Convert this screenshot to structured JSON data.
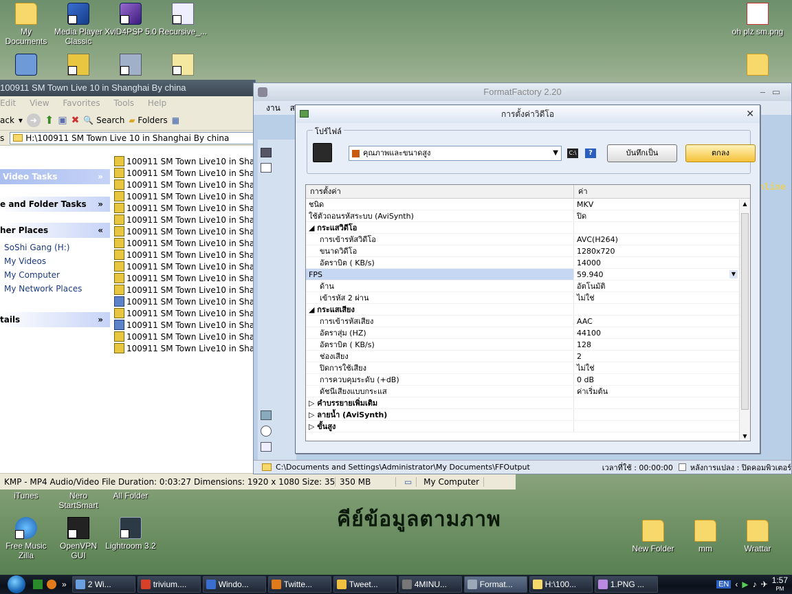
{
  "desktop_icons": [
    {
      "label": "My Documents",
      "icon": "my-documents-icon"
    },
    {
      "label": "Media Player Classic",
      "icon": "media-player-icon"
    },
    {
      "label": "XviD4PSP 5.0",
      "icon": "xvid-icon"
    },
    {
      "label": "Recursive_...",
      "icon": "recursive-icon"
    },
    {
      "label": "oh plz sm.png",
      "icon": "png-file-icon"
    },
    {
      "label": "iTunes",
      "icon": "itunes-icon"
    },
    {
      "label": "Nero StartSmart",
      "icon": "nero-icon"
    },
    {
      "label": "All Folder",
      "icon": "folder-icon"
    },
    {
      "label": "Free Music Zilla",
      "icon": "music-icon"
    },
    {
      "label": "OpenVPN GUI",
      "icon": "openvpn-icon"
    },
    {
      "label": "Lightroom 3.2",
      "icon": "lightroom-icon"
    },
    {
      "label": "New Folder",
      "icon": "folder-icon"
    },
    {
      "label": "mm",
      "icon": "folder-icon"
    },
    {
      "label": "Wrattar",
      "icon": "folder-icon"
    }
  ],
  "explorer": {
    "title": "100911 SM Town Live 10 in Shanghai By china",
    "menu": [
      "Edit",
      "View",
      "Favorites",
      "Tools",
      "Help"
    ],
    "toolbar": {
      "back": "ack",
      "search": "Search",
      "folders": "Folders"
    },
    "address": "H:\\100911 SM Town Live 10 in Shanghai By china",
    "address_label": "s",
    "taskpane": {
      "video_tasks": "Video Tasks",
      "file_folder_tasks": "e and Folder Tasks",
      "other_places": "her Places",
      "places": [
        "SoShi Gang (H:)",
        "My Videos",
        "My Computer",
        "My Network Places"
      ],
      "details": "tails"
    },
    "files": [
      {
        "name": "100911 SM Town Live10 in Shan",
        "type": "mpv"
      },
      {
        "name": "100911 SM Town Live10 in Shan",
        "type": "mpv"
      },
      {
        "name": "100911 SM Town Live10 in Shan",
        "type": "mpv"
      },
      {
        "name": "100911 SM Town Live10 in Shan",
        "type": "mpv"
      },
      {
        "name": "100911 SM Town Live10 in Shan",
        "type": "mpv"
      },
      {
        "name": "100911 SM Town Live10 in Shan",
        "type": "mpv"
      },
      {
        "name": "100911 SM Town Live10 in Shan",
        "type": "mpv"
      },
      {
        "name": "100911 SM Town Live10 in Shan",
        "type": "mpv"
      },
      {
        "name": "100911 SM Town Live10 in Shan",
        "type": "mpv"
      },
      {
        "name": "100911 SM Town Live10 in Shan",
        "type": "mpv"
      },
      {
        "name": "100911 SM Town Live10 in Shan",
        "type": "mpv"
      },
      {
        "name": "100911 SM Town Live10 in Shan",
        "type": "mpv"
      },
      {
        "name": "100911 SM Town Live10 in Shan",
        "type": "mov"
      },
      {
        "name": "100911 SM Town Live10 in Shan",
        "type": "mpv"
      },
      {
        "name": "100911 SM Town Live10 in Shan",
        "type": "mov"
      },
      {
        "name": "100911 SM Town Live10 in Shan",
        "type": "mpv"
      },
      {
        "name": "100911 SM Town Live10 in Shan",
        "type": "mpv"
      }
    ],
    "status": {
      "info": "KMP - MP4 Audio/Video File Duration: 0:03:27 Dimensions: 1920 x 1080 Size: 350 MB",
      "size": "350 MB",
      "location": "My Computer"
    }
  },
  "formatfactory": {
    "title": "FormatFactory 2.20",
    "menu": [
      "งาน",
      "ส"
    ],
    "output_path": "C:\\Documents and Settings\\Administrator\\My Documents\\FFOutput",
    "elapsed": "เวลาที่ใช้ : 00:00:00",
    "after_convert": "หลังการแปลง : ปิดคอมพิวเตอร์",
    "side_text": "nline"
  },
  "dialog": {
    "title": "การตั้งค่าวิดีโอ",
    "profile_legend": "โปร์ไฟล์",
    "profile_value": "คุณภาพและขนาดสูง",
    "save_as_label": "บันทึกเป็น",
    "ok_label": "ตกลง",
    "help_label": "?",
    "cmd_label": "C:\\",
    "col_setting": "การตั้งค่า",
    "col_value": "ค่า",
    "rows": [
      {
        "name": "ชนิด",
        "value": "MKV",
        "kind": "item"
      },
      {
        "name": "ใช้ตัวถอนรหัสระบบ (AviSynth)",
        "value": "ปิด",
        "kind": "item"
      },
      {
        "name": "◢ กระแสวิดีโอ",
        "value": "",
        "kind": "cat"
      },
      {
        "name": "การเข้ารหัสวิดีโอ",
        "value": "AVC(H264)",
        "kind": "sub"
      },
      {
        "name": "ขนาดวิดีโอ",
        "value": "1280x720",
        "kind": "sub"
      },
      {
        "name": "อัตราบิต ( KB/s)",
        "value": "14000",
        "kind": "sub"
      },
      {
        "name": "FPS",
        "value": "59.940",
        "kind": "sel"
      },
      {
        "name": "ด้าน",
        "value": "อัตโนมัติ",
        "kind": "sub"
      },
      {
        "name": "เข้ารหัส 2 ผ่าน",
        "value": "ไม่ใช่",
        "kind": "sub"
      },
      {
        "name": "◢ กระแสเสียง",
        "value": "",
        "kind": "cat"
      },
      {
        "name": "การเข้ารหัสเสียง",
        "value": "AAC",
        "kind": "sub"
      },
      {
        "name": "อัตราสุ่ม (HZ)",
        "value": "44100",
        "kind": "sub"
      },
      {
        "name": "อัตราบิต ( KB/s)",
        "value": "128",
        "kind": "sub"
      },
      {
        "name": "ช่องเสียง",
        "value": "2",
        "kind": "sub"
      },
      {
        "name": "ปิดการใช้เสียง",
        "value": "ไม่ใช่",
        "kind": "sub"
      },
      {
        "name": "การควบคุมระดับ (+dB)",
        "value": "0 dB",
        "kind": "sub"
      },
      {
        "name": "ดัชนีเสียงแบบกระแส",
        "value": "ค่าเริ่มต้น",
        "kind": "sub"
      },
      {
        "name": "▷ คำบรรยายเพิ่มเติม",
        "value": "",
        "kind": "cat"
      },
      {
        "name": "▷ ลายน้ำ (AviSynth)",
        "value": "",
        "kind": "cat"
      },
      {
        "name": "▷ ขั้นสูง",
        "value": "",
        "kind": "cat"
      }
    ]
  },
  "banner": "คีย์ข้อมูลตามภาพ",
  "taskbar": {
    "buttons": [
      {
        "label": "2 Wi...",
        "color": "#6aa0e0",
        "active": false
      },
      {
        "label": "trivium....",
        "color": "#d8402a",
        "active": false
      },
      {
        "label": "Windo...",
        "color": "#3a6fd0",
        "active": false
      },
      {
        "label": "Twitte...",
        "color": "#e07a1a",
        "active": false
      },
      {
        "label": "Tweet...",
        "color": "#f0c040",
        "active": false
      },
      {
        "label": "4MINU...",
        "color": "#777777",
        "active": false
      },
      {
        "label": "Format...",
        "color": "#9aa8b8",
        "active": true
      },
      {
        "label": "H:\\100...",
        "color": "#f7d86a",
        "active": false
      },
      {
        "label": "1.PNG ...",
        "color": "#b98ae0",
        "active": false
      }
    ],
    "lang": "EN",
    "clock": "1:57",
    "ampm": "PM"
  }
}
